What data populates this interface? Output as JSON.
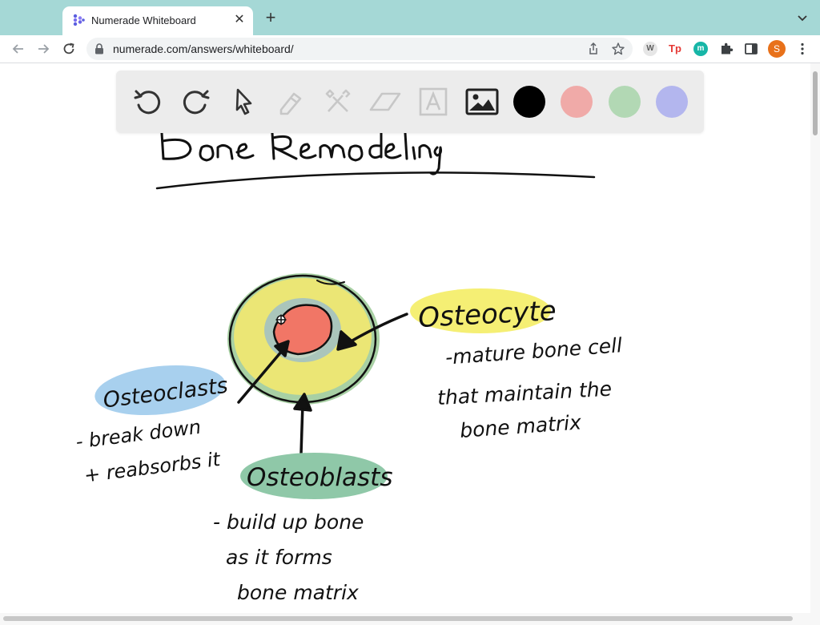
{
  "browser": {
    "tab_title": "Numerade Whiteboard",
    "url": "numerade.com/answers/whiteboard/",
    "profile_initial": "S",
    "extensions": [
      {
        "label": "W",
        "color": "#9e9e9e"
      },
      {
        "label": "Tp",
        "color": "#e53935"
      },
      {
        "label": "m",
        "color": "#17b6a7"
      }
    ]
  },
  "toolbar": {
    "tools": [
      "undo-icon",
      "redo-icon",
      "select-cursor-icon",
      "pen-icon",
      "tools-icon",
      "eraser-icon",
      "text-icon",
      "image-icon"
    ],
    "colors": [
      "#000000",
      "#f0aaa8",
      "#b2d8b4",
      "#b3b6ee"
    ]
  },
  "drawing": {
    "title": "Bone Remodeling",
    "labels": {
      "osteocyte": "Osteocyte",
      "osteoclasts": "Osteoclasts",
      "osteoblasts": "Osteoblasts"
    },
    "notes": {
      "osteocyte": [
        "-mature bone cell",
        "that maintain the",
        "bone matrix"
      ],
      "osteoclasts": [
        "- break down",
        "+ reabsorbs it"
      ],
      "osteoblasts": [
        "- build up bone",
        "as it forms",
        "bone matrix"
      ]
    },
    "highlight_colors": {
      "osteocyte": "#f6f07a",
      "osteoclasts": "#a9d1ee",
      "osteoblasts": "#8fc9a9",
      "outer_ring": "#9dc69a",
      "inner_fill": "#ece77a",
      "core": "#f07466"
    }
  }
}
